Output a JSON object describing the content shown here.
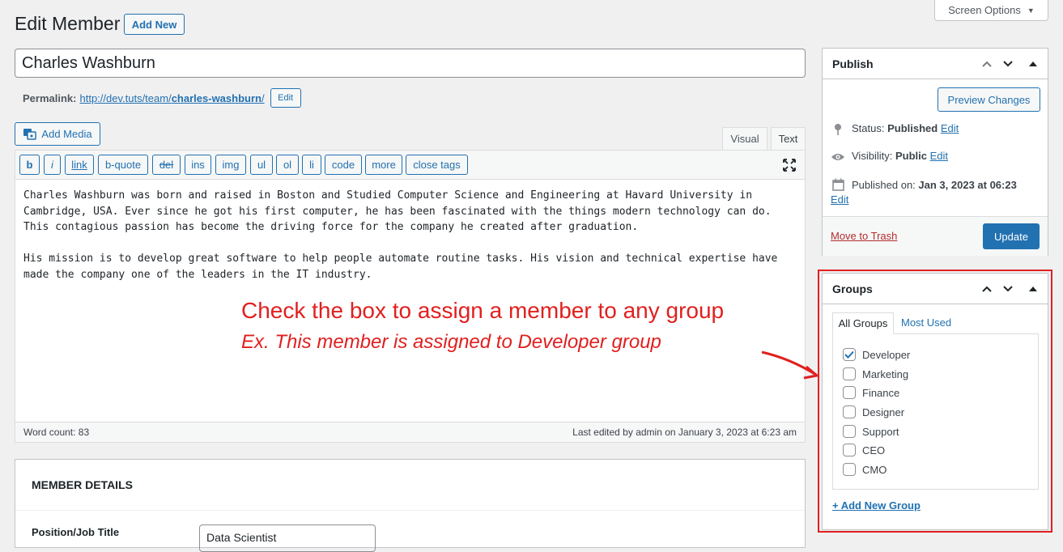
{
  "header": {
    "title": "Edit Member",
    "add_new_label": "Add New",
    "screen_options_label": "Screen Options"
  },
  "post": {
    "title": "Charles Washburn",
    "permalink_label": "Permalink:",
    "permalink_base": "http://dev.tuts/team/",
    "permalink_slug": "charles-washburn",
    "permalink_trailing": "/",
    "permalink_edit_label": "Edit"
  },
  "editor": {
    "add_media_label": "Add Media",
    "tab_visual": "Visual",
    "tab_text": "Text",
    "quicktags": [
      "b",
      "i",
      "link",
      "b-quote",
      "del",
      "ins",
      "img",
      "ul",
      "ol",
      "li",
      "code",
      "more",
      "close tags"
    ],
    "content": "Charles Washburn was born and raised in Boston and Studied Computer Science and Engineering at Havard University in\nCambridge, USA. Ever since he got his first computer, he has been fascinated with the things modern technology can do.\nThis contagious passion has become the driving force for the company he created after graduation.\n\nHis mission is to develop great software to help people automate routine tasks. His vision and technical expertise have\nmade the company one of the leaders in the IT industry.",
    "word_count": "Word count: 83",
    "last_edited": "Last edited by admin on January 3, 2023 at 6:23 am"
  },
  "annotation": {
    "line1": "Check the box to assign a member to any group",
    "line2": "Ex. This member is assigned to Developer group",
    "color": "#e0201f"
  },
  "member_details": {
    "title": "MEMBER DETAILS",
    "position_label": "Position/Job Title",
    "position_value": "Data Scientist"
  },
  "publish": {
    "title": "Publish",
    "preview_label": "Preview Changes",
    "status_label": "Status:",
    "status_value": "Published",
    "visibility_label": "Visibility:",
    "visibility_value": "Public",
    "published_label": "Published on:",
    "published_value": "Jan 3, 2023 at 06:23",
    "edit_label": "Edit",
    "trash_label": "Move to Trash",
    "update_label": "Update"
  },
  "groups": {
    "title": "Groups",
    "tab_all": "All Groups",
    "tab_most_used": "Most Used",
    "items": [
      {
        "label": "Developer",
        "checked": true
      },
      {
        "label": "Marketing",
        "checked": false
      },
      {
        "label": "Finance",
        "checked": false
      },
      {
        "label": "Designer",
        "checked": false
      },
      {
        "label": "Support",
        "checked": false
      },
      {
        "label": "CEO",
        "checked": false
      },
      {
        "label": "CMO",
        "checked": false
      }
    ],
    "add_new_label": "+ Add New Group"
  },
  "colors": {
    "accent": "#2271b1",
    "danger": "#b32d2e",
    "highlight": "#e0201f"
  }
}
